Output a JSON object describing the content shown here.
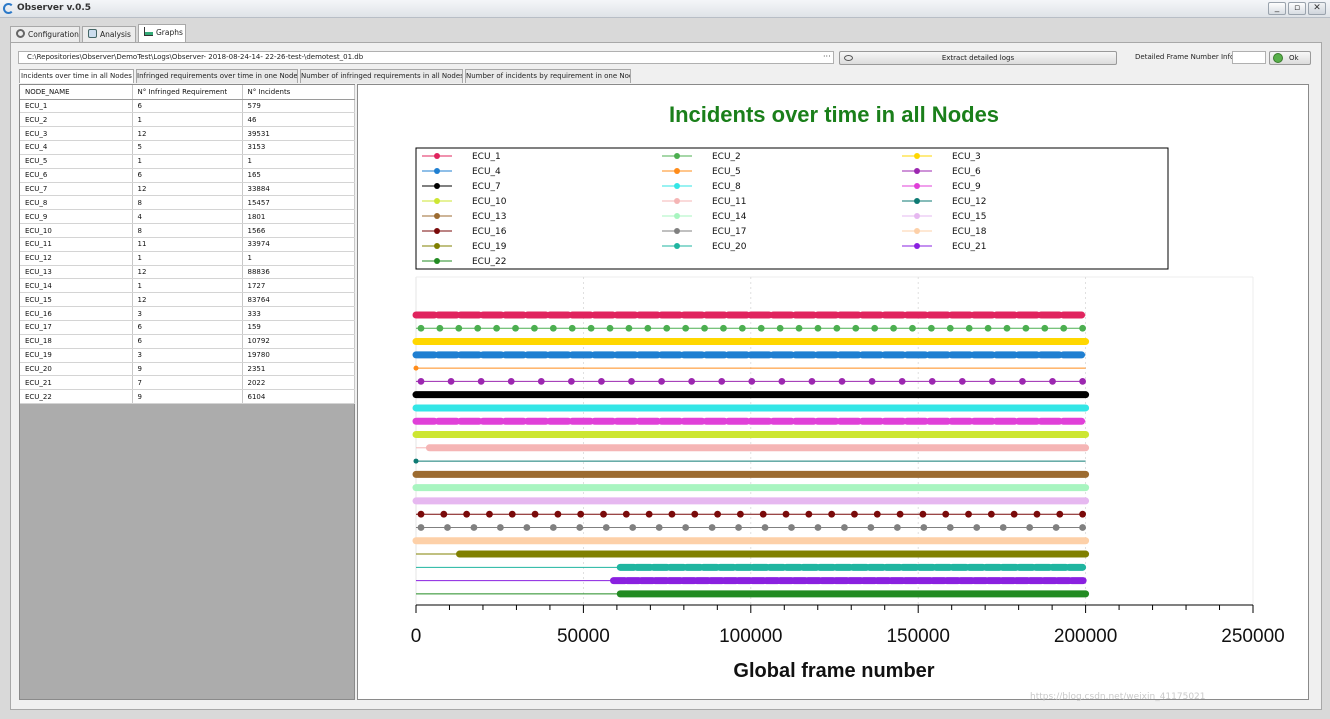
{
  "window": {
    "title": "Observer v.0.5",
    "minimize_label": "_",
    "maximize_label": "▫",
    "close_label": "✕"
  },
  "main_tabs": [
    {
      "label": "Configuration",
      "icon": "gear-icon"
    },
    {
      "label": "Analysis",
      "icon": "analysis-icon"
    },
    {
      "label": "Graphs",
      "icon": "graph-icon"
    }
  ],
  "toolbar": {
    "path_value": "C:\\Repositories\\Observer\\DemoTest\\Logs\\Observer- 2018-08-24-14- 22-26-test-\\demotest_01.db",
    "browse_label": "···",
    "extract_label": "Extract detailed logs",
    "frame_label": "Detailed Frame Number Info",
    "frame_value": "",
    "ok_label": "Ok"
  },
  "sub_tabs": [
    "Incidents over time in all Nodes",
    "Infringed requirements over time in one Node",
    "Number of infringed requirements in all Nodes",
    "Number of incidents by requirement in one Node"
  ],
  "table": {
    "headers": [
      "NODE_NAME",
      "N° Infringed Requirement",
      "N° Incidents"
    ],
    "rows": [
      [
        "ECU_1",
        "6",
        "579"
      ],
      [
        "ECU_2",
        "1",
        "46"
      ],
      [
        "ECU_3",
        "12",
        "39531"
      ],
      [
        "ECU_4",
        "5",
        "3153"
      ],
      [
        "ECU_5",
        "1",
        "1"
      ],
      [
        "ECU_6",
        "6",
        "165"
      ],
      [
        "ECU_7",
        "12",
        "33884"
      ],
      [
        "ECU_8",
        "8",
        "15457"
      ],
      [
        "ECU_9",
        "4",
        "1801"
      ],
      [
        "ECU_10",
        "8",
        "1566"
      ],
      [
        "ECU_11",
        "11",
        "33974"
      ],
      [
        "ECU_12",
        "1",
        "1"
      ],
      [
        "ECU_13",
        "12",
        "88836"
      ],
      [
        "ECU_14",
        "1",
        "1727"
      ],
      [
        "ECU_15",
        "12",
        "83764"
      ],
      [
        "ECU_16",
        "3",
        "333"
      ],
      [
        "ECU_17",
        "6",
        "159"
      ],
      [
        "ECU_18",
        "6",
        "10792"
      ],
      [
        "ECU_19",
        "3",
        "19780"
      ],
      [
        "ECU_20",
        "9",
        "2351"
      ],
      [
        "ECU_21",
        "7",
        "2022"
      ],
      [
        "ECU_22",
        "9",
        "6104"
      ]
    ]
  },
  "chart_data": {
    "type": "scatter",
    "title": "Incidents over time in all Nodes",
    "title_color": "#1a7f1a",
    "xlabel": "Global frame number",
    "ylabel": "",
    "xlim": [
      0,
      250000
    ],
    "xticks": [
      "0",
      "50000",
      "100000",
      "150000",
      "200000",
      "250000"
    ],
    "grid": true,
    "legend_position": "top",
    "series": [
      {
        "name": "ECU_1",
        "color": "#e0245e",
        "x_start": 0,
        "x_end": 200000,
        "pattern": "dense",
        "points": 30
      },
      {
        "name": "ECU_2",
        "color": "#4caf50",
        "x_start": 0,
        "x_end": 200000,
        "pattern": "sparse",
        "points": 36
      },
      {
        "name": "ECU_3",
        "color": "#ffd700",
        "x_start": 0,
        "x_end": 200000,
        "pattern": "solid",
        "points": 0
      },
      {
        "name": "ECU_4",
        "color": "#1f7fd1",
        "x_start": 0,
        "x_end": 200000,
        "pattern": "dense",
        "points": 30
      },
      {
        "name": "ECU_5",
        "color": "#ff8c1a",
        "x_start": 0,
        "x_end": 200000,
        "pattern": "single",
        "points": 1
      },
      {
        "name": "ECU_6",
        "color": "#9c27b0",
        "x_start": 0,
        "x_end": 200000,
        "pattern": "sparse",
        "points": 23
      },
      {
        "name": "ECU_7",
        "color": "#000000",
        "x_start": 0,
        "x_end": 200000,
        "pattern": "solid",
        "points": 0
      },
      {
        "name": "ECU_8",
        "color": "#33e6e6",
        "x_start": 0,
        "x_end": 200000,
        "pattern": "solid",
        "points": 0
      },
      {
        "name": "ECU_9",
        "color": "#e040d8",
        "x_start": 0,
        "x_end": 200000,
        "pattern": "dense",
        "points": 30
      },
      {
        "name": "ECU_10",
        "color": "#cde632",
        "x_start": 0,
        "x_end": 200000,
        "pattern": "solid",
        "points": 0
      },
      {
        "name": "ECU_11",
        "color": "#f5b5b5",
        "x_start": 4000,
        "x_end": 200000,
        "pattern": "solid",
        "points": 0
      },
      {
        "name": "ECU_12",
        "color": "#0d7a73",
        "x_start": 0,
        "x_end": 200000,
        "pattern": "single",
        "points": 1
      },
      {
        "name": "ECU_13",
        "color": "#9c6b30",
        "x_start": 0,
        "x_end": 200000,
        "pattern": "solid",
        "points": 0
      },
      {
        "name": "ECU_14",
        "color": "#a8f5c0",
        "x_start": 0,
        "x_end": 200000,
        "pattern": "solid",
        "points": 0
      },
      {
        "name": "ECU_15",
        "color": "#e6b8f0",
        "x_start": 0,
        "x_end": 200000,
        "pattern": "solid",
        "points": 0
      },
      {
        "name": "ECU_16",
        "color": "#7a0a0a",
        "x_start": 0,
        "x_end": 200000,
        "pattern": "sparse",
        "points": 30
      },
      {
        "name": "ECU_17",
        "color": "#808080",
        "x_start": 0,
        "x_end": 200000,
        "pattern": "sparse",
        "points": 26
      },
      {
        "name": "ECU_18",
        "color": "#fdd0a8",
        "x_start": 0,
        "x_end": 200000,
        "pattern": "solid",
        "points": 0
      },
      {
        "name": "ECU_19",
        "color": "#808000",
        "x_start": 13000,
        "x_end": 200000,
        "pattern": "solid",
        "points": 0
      },
      {
        "name": "ECU_20",
        "color": "#1fb5a0",
        "x_start": 61000,
        "x_end": 200000,
        "pattern": "dense",
        "points": 28
      },
      {
        "name": "ECU_21",
        "color": "#8a20e0",
        "x_start": 59000,
        "x_end": 200000,
        "pattern": "dense",
        "points": 34
      },
      {
        "name": "ECU_22",
        "color": "#228b22",
        "x_start": 61000,
        "x_end": 200000,
        "pattern": "solid",
        "points": 0
      }
    ]
  },
  "watermark": "https://blog.csdn.net/weixin_41175021"
}
